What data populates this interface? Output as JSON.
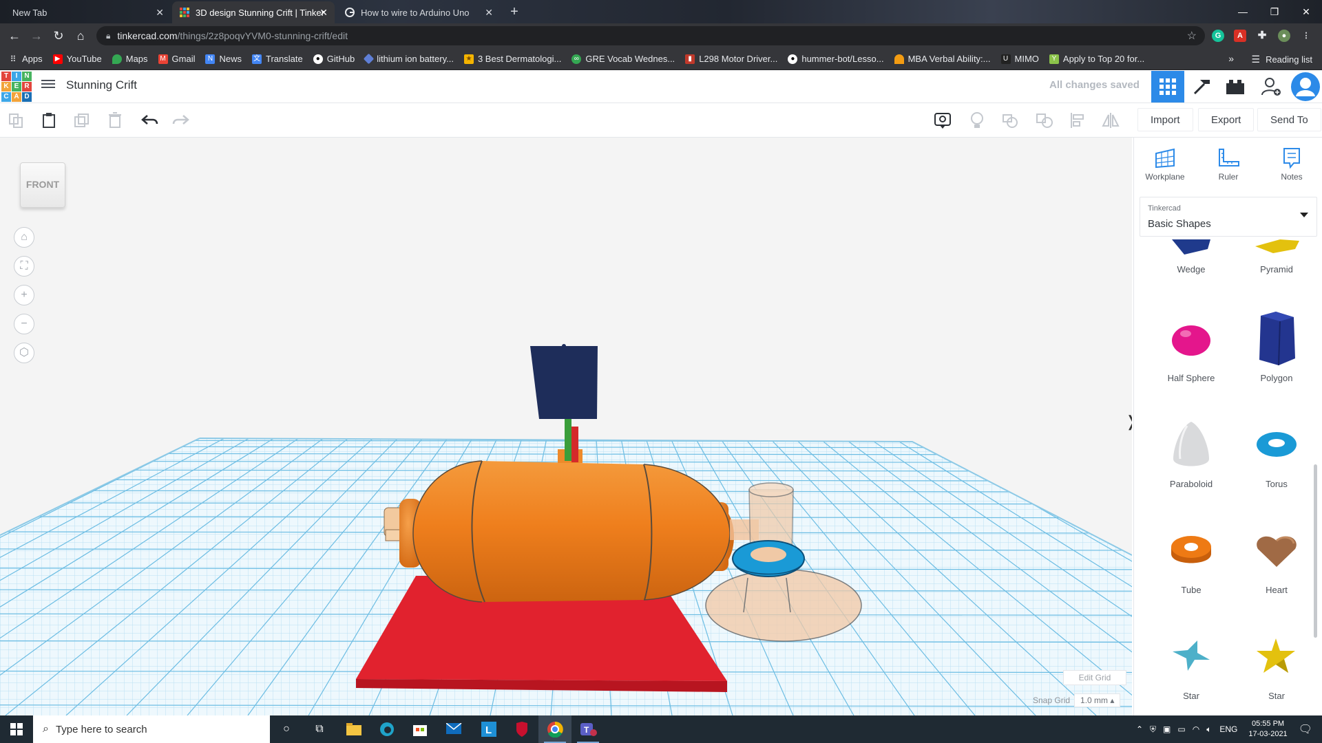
{
  "browser": {
    "tabs": [
      {
        "title": "New Tab",
        "active": false
      },
      {
        "title": "3D design Stunning Crift | Tinker",
        "active": true
      },
      {
        "title": "How to wire to Arduino Uno",
        "active": false
      }
    ],
    "url_host": "tinkercad.com",
    "url_path": "/things/2z8poqvYVM0-stunning-crift/edit",
    "bookmarks": [
      "Apps",
      "YouTube",
      "Maps",
      "Gmail",
      "News",
      "Translate",
      "GitHub",
      "lithium ion battery...",
      "3 Best Dermatologi...",
      "GRE Vocab Wednes...",
      "L298 Motor Driver...",
      "hummer-bot/Lesso...",
      "MBA Verbal Ability:...",
      "MIMO",
      "Apply to Top 20 for..."
    ],
    "bookmarks_more": "»",
    "reading_list": "Reading list"
  },
  "app": {
    "logo_letters": [
      "T",
      "I",
      "N",
      "K",
      "E",
      "R",
      "C",
      "A",
      "D"
    ],
    "design_title": "Stunning Crift",
    "save_status": "All changes saved"
  },
  "toolbar": {
    "import_label": "Import",
    "export_label": "Export",
    "sendto_label": "Send To"
  },
  "viewport": {
    "viewcube_label": "FRONT",
    "edit_grid_label": "Edit Grid",
    "snap_grid_label": "Snap Grid",
    "snap_grid_value": "1.0 mm ▴"
  },
  "panel": {
    "workplane_label": "Workplane",
    "ruler_label": "Ruler",
    "notes_label": "Notes",
    "library_category": "Tinkercad",
    "library_name": "Basic Shapes",
    "shapes": [
      "Wedge",
      "Pyramid",
      "Half Sphere",
      "Polygon",
      "Paraboloid",
      "Torus",
      "Tube",
      "Heart",
      "Star",
      "Star"
    ]
  },
  "taskbar": {
    "search_placeholder": "Type here to search",
    "language": "ENG",
    "time": "05:55 PM",
    "date": "17-03-2021"
  },
  "colors": {
    "brand_blue": "#2c8ae8",
    "box_red": "#e1222e",
    "body_orange": "#ef7f1d",
    "flag_navy": "#1e2d5a",
    "torus_blue": "#1a9ad6",
    "grid_blue": "#9fd3ec"
  }
}
